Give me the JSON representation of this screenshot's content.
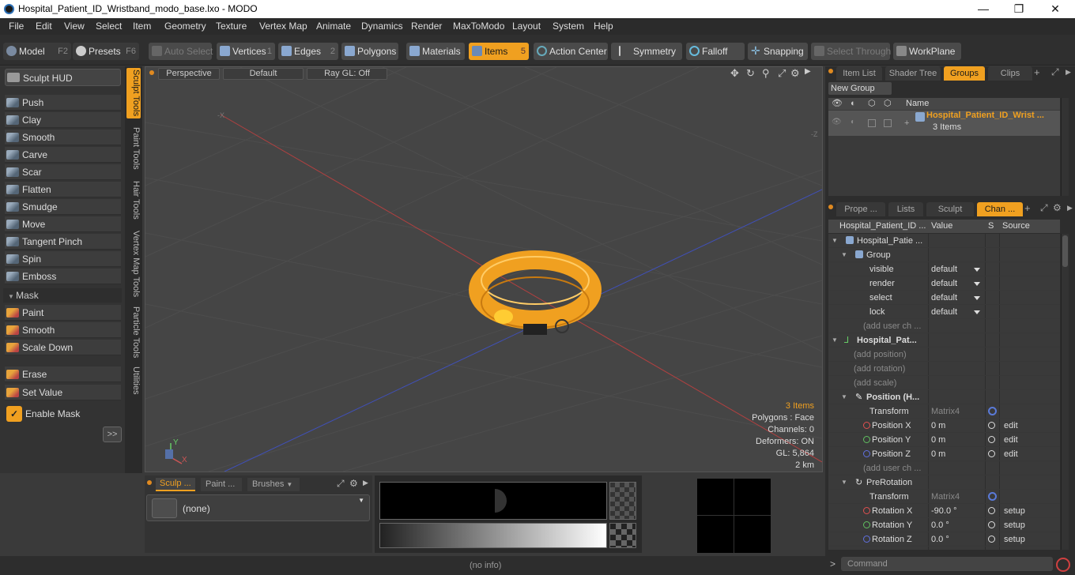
{
  "titlebar": {
    "title": "Hospital_Patient_ID_Wristband_modo_base.lxo - MODO",
    "minimize": "—",
    "maximize": "❐",
    "close": "✕"
  },
  "menu": [
    "File",
    "Edit",
    "View",
    "Select",
    "Item",
    "Geometry",
    "Texture",
    "Vertex Map",
    "Animate",
    "Dynamics",
    "Render",
    "MaxToModo",
    "Layout",
    "System",
    "Help"
  ],
  "toolbar": {
    "model": "Model",
    "model_key": "F2",
    "presets": "Presets",
    "presets_key": "F6",
    "auto_select": "Auto Select",
    "vertices": "Vertices",
    "vertices_key": "1",
    "edges": "Edges",
    "edges_key": "2",
    "polygons": "Polygons",
    "materials": "Materials",
    "items": "Items",
    "items_key": "5",
    "action_center": "Action Center",
    "symmetry": "Symmetry",
    "falloff": "Falloff",
    "snapping": "Snapping",
    "select_through": "Select Through",
    "workplane": "WorkPlane"
  },
  "left": {
    "sculpt_hud": "Sculpt HUD",
    "tools": [
      "Push",
      "Clay",
      "Smooth",
      "Carve",
      "Scar",
      "Flatten",
      "Smudge",
      "Move",
      "Tangent Pinch",
      "Spin",
      "Emboss"
    ],
    "mask_header": "Mask",
    "mask_tools": [
      "Paint",
      "Smooth",
      "Scale Down"
    ],
    "erase": "Erase",
    "set_value": "Set Value",
    "enable_mask": "Enable Mask",
    "more": ">>"
  },
  "sidetabs": [
    "Sculpt Tools",
    "Paint Tools",
    "Hair Tools",
    "Vertex Map Tools",
    "Particle Tools",
    "Utilities"
  ],
  "viewport": {
    "perspective": "Perspective",
    "default": "Default",
    "raygl": "Ray GL: Off",
    "stats": {
      "items": "3 Items",
      "polygons": "Polygons : Face",
      "channels": "Channels: 0",
      "deformers": "Deformers: ON",
      "gl": "GL: 5,864",
      "scale": "2 km"
    },
    "axis_y": "Y",
    "axis_x": "X"
  },
  "bottom": {
    "tab1": "Sculp ...",
    "tab2": "Paint ...",
    "tab3": "Brushes",
    "none": "(none)"
  },
  "status": {
    "info": "(no info)",
    "command": "Command"
  },
  "right_top": {
    "tabs": [
      "Item List",
      "Shader Tree",
      "Groups",
      "Clips"
    ],
    "new_group": "New Group",
    "name_col": "Name",
    "group_name": "Hospital_Patient_ID_Wrist ...",
    "group_count": "3 Items"
  },
  "right_bottom": {
    "tabs": [
      "Prope ...",
      "Lists",
      "Sculpt",
      "Chan ..."
    ],
    "cols": {
      "name": "Hospital_Patient_ID ...",
      "value": "Value",
      "s": "S",
      "source": "Source"
    },
    "rows": [
      {
        "name": "Hospital_Patie ...",
        "value": "",
        "src": ""
      },
      {
        "name": "Group",
        "value": "",
        "src": ""
      },
      {
        "name": "visible",
        "value": "default",
        "src": ""
      },
      {
        "name": "render",
        "value": "default",
        "src": ""
      },
      {
        "name": "select",
        "value": "default",
        "src": ""
      },
      {
        "name": "lock",
        "value": "default",
        "src": ""
      },
      {
        "name": "(add user ch ...",
        "value": "",
        "src": ""
      },
      {
        "name": "Hospital_Pat...",
        "value": "",
        "src": ""
      },
      {
        "name": "(add position)",
        "value": "",
        "src": ""
      },
      {
        "name": "(add rotation)",
        "value": "",
        "src": ""
      },
      {
        "name": "(add scale)",
        "value": "",
        "src": ""
      },
      {
        "name": "Position (H...",
        "value": "",
        "src": ""
      },
      {
        "name": "Transform",
        "value": "Matrix4",
        "src": ""
      },
      {
        "name": "Position X",
        "value": "0 m",
        "src": "edit"
      },
      {
        "name": "Position Y",
        "value": "0 m",
        "src": "edit"
      },
      {
        "name": "Position Z",
        "value": "0 m",
        "src": "edit"
      },
      {
        "name": "(add user ch ...",
        "value": "",
        "src": ""
      },
      {
        "name": "PreRotation",
        "value": "",
        "src": ""
      },
      {
        "name": "Transform",
        "value": "Matrix4",
        "src": ""
      },
      {
        "name": "Rotation X",
        "value": "-90.0 °",
        "src": "setup"
      },
      {
        "name": "Rotation Y",
        "value": "0.0 °",
        "src": "setup"
      },
      {
        "name": "Rotation Z",
        "value": "0.0 °",
        "src": "setup"
      }
    ]
  },
  "colors": {
    "accent": "#f0a020",
    "bg": "#3a3a3a",
    "axis_x": "#c04040",
    "axis_z": "#4050c0"
  }
}
